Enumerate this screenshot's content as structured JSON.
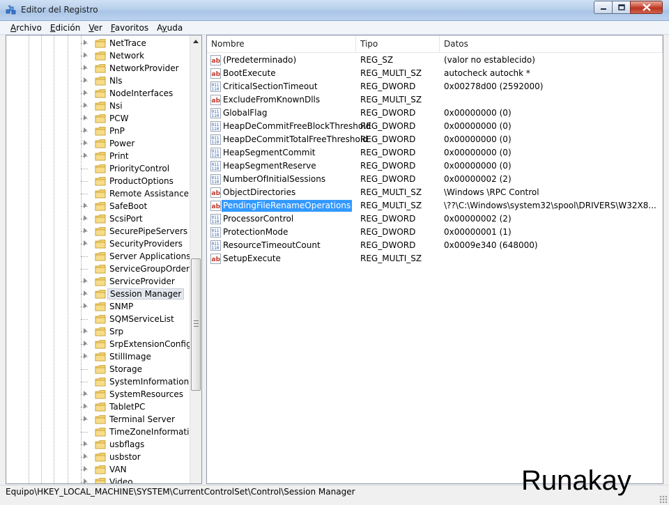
{
  "window": {
    "title": "Editor del Registro",
    "accent_color": "#3399ff"
  },
  "menu": [
    {
      "label": "Archivo",
      "accel": "A",
      "rest": "rchivo"
    },
    {
      "label": "Edición",
      "accel": "E",
      "rest": "dición"
    },
    {
      "label": "Ver",
      "accel": "V",
      "rest": "er"
    },
    {
      "label": "Favoritos",
      "accel": "F",
      "rest": "avoritos"
    },
    {
      "label": "Ayuda",
      "accel": "y",
      "pre": "A",
      "rest": "uda"
    }
  ],
  "tree": {
    "selected": "Session Manager",
    "items": [
      {
        "label": "NetTrace",
        "expandable": true
      },
      {
        "label": "Network",
        "expandable": true
      },
      {
        "label": "NetworkProvider",
        "expandable": true
      },
      {
        "label": "Nls",
        "expandable": true
      },
      {
        "label": "NodeInterfaces",
        "expandable": true
      },
      {
        "label": "Nsi",
        "expandable": true
      },
      {
        "label": "PCW",
        "expandable": true
      },
      {
        "label": "PnP",
        "expandable": true
      },
      {
        "label": "Power",
        "expandable": true
      },
      {
        "label": "Print",
        "expandable": true
      },
      {
        "label": "PriorityControl",
        "expandable": false
      },
      {
        "label": "ProductOptions",
        "expandable": false
      },
      {
        "label": "Remote Assistance",
        "expandable": false
      },
      {
        "label": "SafeBoot",
        "expandable": true
      },
      {
        "label": "ScsiPort",
        "expandable": true
      },
      {
        "label": "SecurePipeServers",
        "expandable": true
      },
      {
        "label": "SecurityProviders",
        "expandable": true
      },
      {
        "label": "Server Applications",
        "expandable": false
      },
      {
        "label": "ServiceGroupOrder",
        "expandable": false
      },
      {
        "label": "ServiceProvider",
        "expandable": true
      },
      {
        "label": "Session Manager",
        "expandable": true
      },
      {
        "label": "SNMP",
        "expandable": true
      },
      {
        "label": "SQMServiceList",
        "expandable": false
      },
      {
        "label": "Srp",
        "expandable": true
      },
      {
        "label": "SrpExtensionConfig",
        "expandable": true
      },
      {
        "label": "StillImage",
        "expandable": true
      },
      {
        "label": "Storage",
        "expandable": false
      },
      {
        "label": "SystemInformation",
        "expandable": false
      },
      {
        "label": "SystemResources",
        "expandable": true
      },
      {
        "label": "TabletPC",
        "expandable": true
      },
      {
        "label": "Terminal Server",
        "expandable": true
      },
      {
        "label": "TimeZoneInformation",
        "expandable": false
      },
      {
        "label": "usbflags",
        "expandable": true
      },
      {
        "label": "usbstor",
        "expandable": true
      },
      {
        "label": "VAN",
        "expandable": true
      },
      {
        "label": "Video",
        "expandable": true
      }
    ]
  },
  "columns": {
    "name": "Nombre",
    "type": "Tipo",
    "data": "Datos"
  },
  "values": [
    {
      "icon": "string-value-icon",
      "name": "(Predeterminado)",
      "type": "REG_SZ",
      "data": "(valor no establecido)"
    },
    {
      "icon": "string-value-icon",
      "name": "BootExecute",
      "type": "REG_MULTI_SZ",
      "data": "autocheck autochk *"
    },
    {
      "icon": "binary-value-icon",
      "name": "CriticalSectionTimeout",
      "type": "REG_DWORD",
      "data": "0x00278d00 (2592000)"
    },
    {
      "icon": "string-value-icon",
      "name": "ExcludeFromKnownDlls",
      "type": "REG_MULTI_SZ",
      "data": ""
    },
    {
      "icon": "binary-value-icon",
      "name": "GlobalFlag",
      "type": "REG_DWORD",
      "data": "0x00000000 (0)"
    },
    {
      "icon": "binary-value-icon",
      "name": "HeapDeCommitFreeBlockThreshold",
      "type": "REG_DWORD",
      "data": "0x00000000 (0)"
    },
    {
      "icon": "binary-value-icon",
      "name": "HeapDeCommitTotalFreeThreshold",
      "type": "REG_DWORD",
      "data": "0x00000000 (0)"
    },
    {
      "icon": "binary-value-icon",
      "name": "HeapSegmentCommit",
      "type": "REG_DWORD",
      "data": "0x00000000 (0)"
    },
    {
      "icon": "binary-value-icon",
      "name": "HeapSegmentReserve",
      "type": "REG_DWORD",
      "data": "0x00000000 (0)"
    },
    {
      "icon": "binary-value-icon",
      "name": "NumberOfInitialSessions",
      "type": "REG_DWORD",
      "data": "0x00000002 (2)"
    },
    {
      "icon": "string-value-icon",
      "name": "ObjectDirectories",
      "type": "REG_MULTI_SZ",
      "data": "\\Windows \\RPC Control"
    },
    {
      "icon": "string-value-icon",
      "name": "PendingFileRenameOperations",
      "type": "REG_MULTI_SZ",
      "data": "\\??\\C:\\Windows\\system32\\spool\\DRIVERS\\W32X8...",
      "selected": true
    },
    {
      "icon": "binary-value-icon",
      "name": "ProcessorControl",
      "type": "REG_DWORD",
      "data": "0x00000002 (2)"
    },
    {
      "icon": "binary-value-icon",
      "name": "ProtectionMode",
      "type": "REG_DWORD",
      "data": "0x00000001 (1)"
    },
    {
      "icon": "binary-value-icon",
      "name": "ResourceTimeoutCount",
      "type": "REG_DWORD",
      "data": "0x0009e340 (648000)"
    },
    {
      "icon": "string-value-icon",
      "name": "SetupExecute",
      "type": "REG_MULTI_SZ",
      "data": ""
    }
  ],
  "statusbar": {
    "path": "Equipo\\HKEY_LOCAL_MACHINE\\SYSTEM\\CurrentControlSet\\Control\\Session Manager"
  },
  "watermark": "Runakay"
}
